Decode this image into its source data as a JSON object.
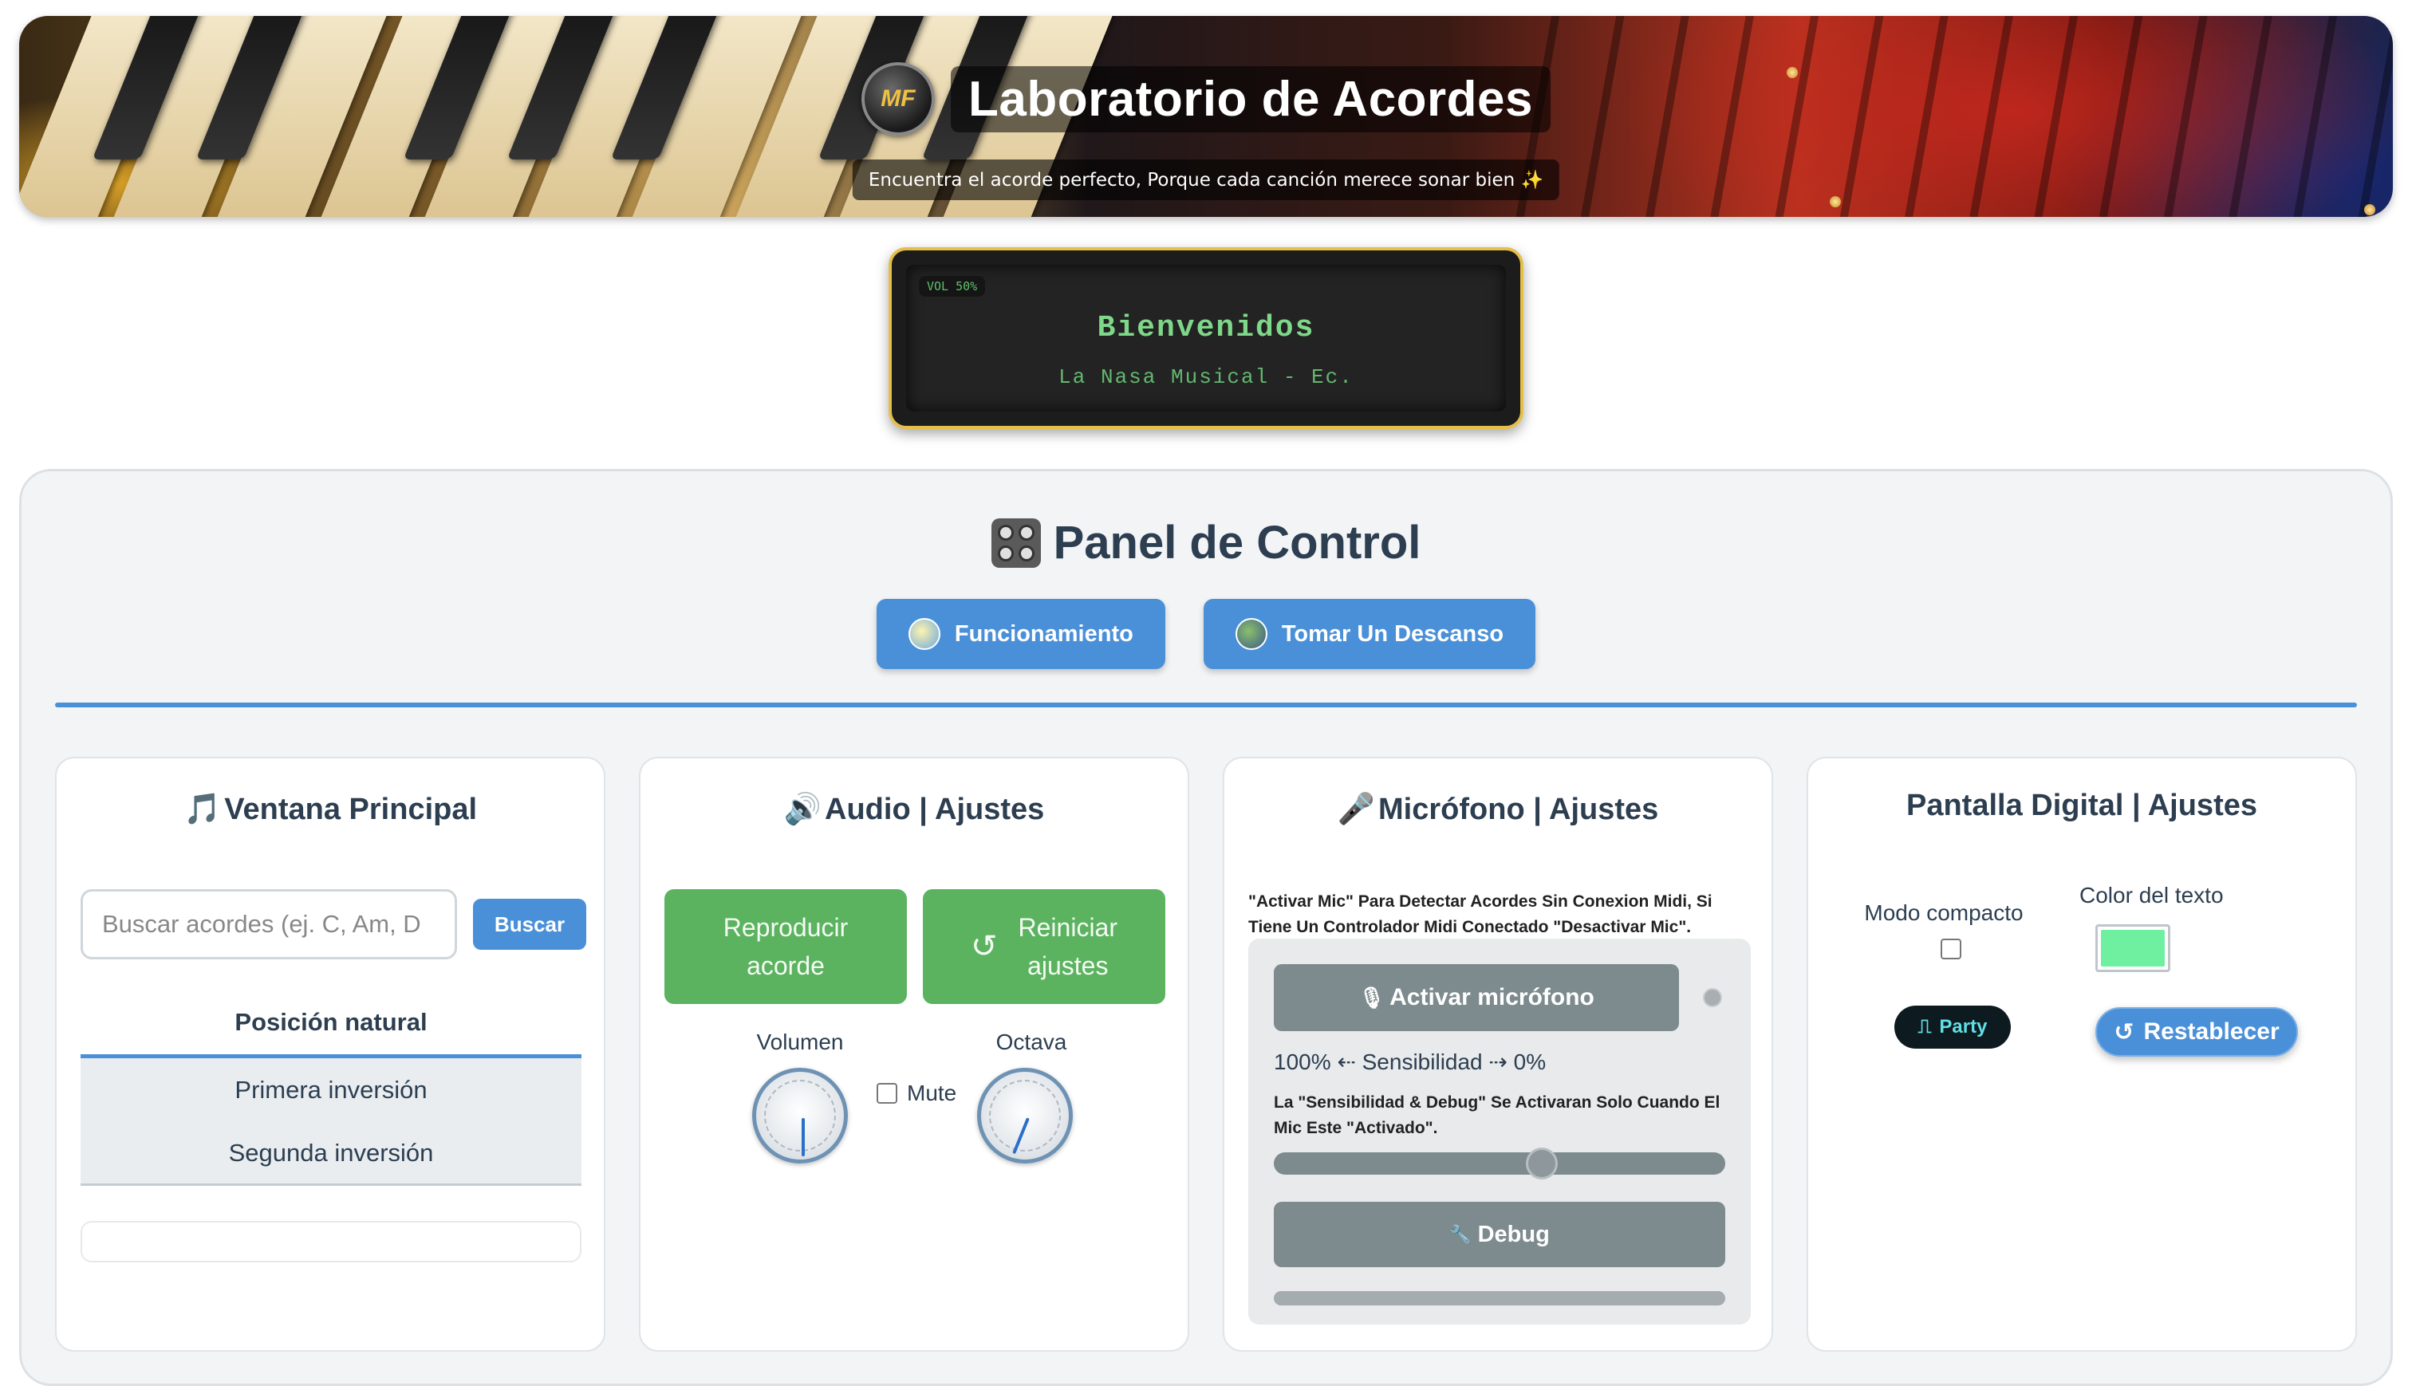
{
  "banner": {
    "logo_text": "MF",
    "title": "Laboratorio de Acordes",
    "subtitle": "Encuentra el acorde perfecto, Porque cada canción merece sonar bien ✨"
  },
  "lcd": {
    "volume_badge": "VOL 50%",
    "title": "Bienvenidos",
    "subtitle": "La Nasa Musical - Ec."
  },
  "panel": {
    "title": "Panel de Control",
    "buttons": [
      {
        "label": "Funcionamiento",
        "icon": "earth-icon"
      },
      {
        "label": "Tomar Un Descanso",
        "icon": "game-icon"
      }
    ]
  },
  "cards": {
    "main": {
      "icon": "🎵",
      "title": "Ventana Principal",
      "search_placeholder": "Buscar acordes (ej. C, Am, D",
      "search_button": "Buscar",
      "inversions": [
        "Posición natural",
        "Primera inversión",
        "Segunda inversión"
      ],
      "active_inversion": 0
    },
    "audio": {
      "icon": "🔊",
      "title": "Audio | Ajustes",
      "play_button_line1": "Reproducir",
      "play_button_line2": "acorde",
      "reset_icon": "↺",
      "reset_button_line1": "Reiniciar",
      "reset_button_line2": "ajustes",
      "volume_label": "Volumen",
      "mute_label": "Mute",
      "mute_checked": false,
      "octave_label": "Octava"
    },
    "mic": {
      "icon": "🎤",
      "title": "Micrófono | Ajustes",
      "note": "\"Activar Mic\" Para Detectar Acordes Sin Conexion Midi, Si Tiene Un Controlador Midi Conectado \"Desactivar Mic\".",
      "activate_button": "Activar micrófono",
      "mic_glyph": "🎙",
      "sensitivity_label": "100% ⇠ Sensibilidad ⇢ 0%",
      "sensitivity_note": "La \"Sensibilidad & Debug\" Se Activaran Solo Cuando El Mic Este \"Activado\".",
      "sensitivity_value": 0.6,
      "debug_button": "Debug",
      "debug_glyph": "🔧"
    },
    "display": {
      "title": "Pantalla Digital | Ajustes",
      "compact_label": "Modo compacto",
      "compact_checked": false,
      "text_color_label": "Color del texto",
      "text_color": "#6ef0a0",
      "party_button": "Party",
      "reset_button": "Restablecer",
      "reset_glyph": "↺"
    }
  },
  "colors": {
    "accent_blue": "#4a90d9",
    "green_button": "#5cb35f",
    "disabled_gray": "#7d8a8e",
    "lcd_border": "#e4c04a",
    "lcd_text": "#7fd88a"
  }
}
